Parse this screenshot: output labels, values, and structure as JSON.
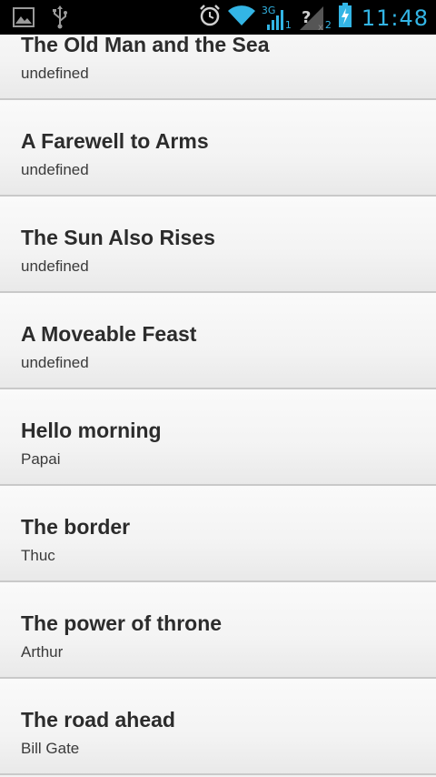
{
  "status_bar": {
    "time": "11:48",
    "network_type": "3G",
    "sim1": "1",
    "sim2": "2",
    "icons": [
      "picture-icon",
      "usb-icon",
      "alarm-icon",
      "wifi-icon",
      "signal-icon",
      "no-sim-signal-icon",
      "battery-charging-icon"
    ]
  },
  "books": [
    {
      "title": "The Old Man and the Sea",
      "author": "undefined"
    },
    {
      "title": "A Farewell to Arms",
      "author": "undefined"
    },
    {
      "title": "The Sun Also Rises",
      "author": "undefined"
    },
    {
      "title": "A Moveable Feast",
      "author": "undefined"
    },
    {
      "title": "Hello morning",
      "author": "Papai"
    },
    {
      "title": "The border",
      "author": "Thuc"
    },
    {
      "title": "The power of throne",
      "author": "Arthur"
    },
    {
      "title": "The road ahead",
      "author": "Bill Gate"
    }
  ],
  "colors": {
    "status_accent": "#33b5e5",
    "status_bg": "#000000",
    "list_bg": "#f2f2f2"
  }
}
